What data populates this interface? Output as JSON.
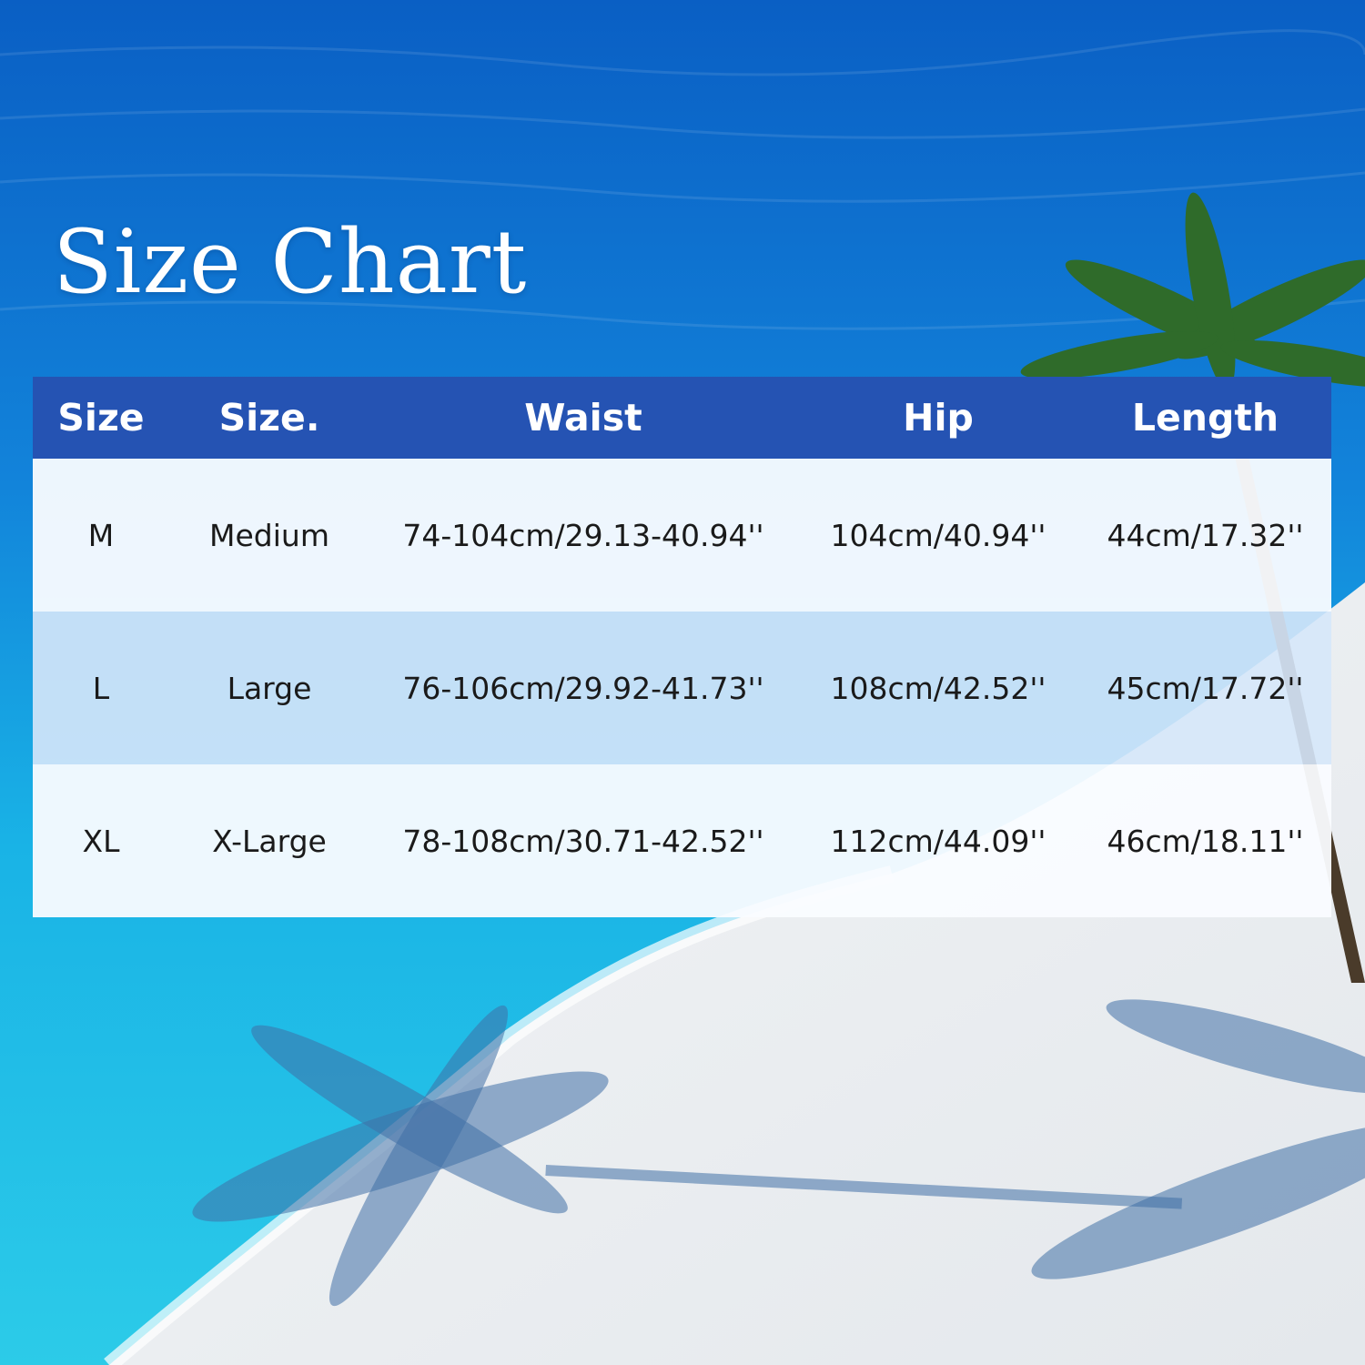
{
  "title": "Size Chart",
  "table": {
    "headers": [
      "Size",
      "Size.",
      "Waist",
      "Hip",
      "Length"
    ],
    "rows": [
      [
        "M",
        "Medium",
        "74-104cm/29.13-40.94''",
        "104cm/40.94''",
        "44cm/17.32''"
      ],
      [
        "L",
        "Large",
        "76-106cm/29.92-41.73''",
        "108cm/42.52''",
        "45cm/17.72''"
      ],
      [
        "XL",
        "X-Large",
        "78-108cm/30.71-42.52''",
        "112cm/44.09''",
        "46cm/18.11''"
      ]
    ]
  },
  "colors": {
    "header_bg": "#2553b3",
    "header_text": "#ffffff",
    "row_light": "#fafcff",
    "row_tint": "#d6e7fa"
  }
}
